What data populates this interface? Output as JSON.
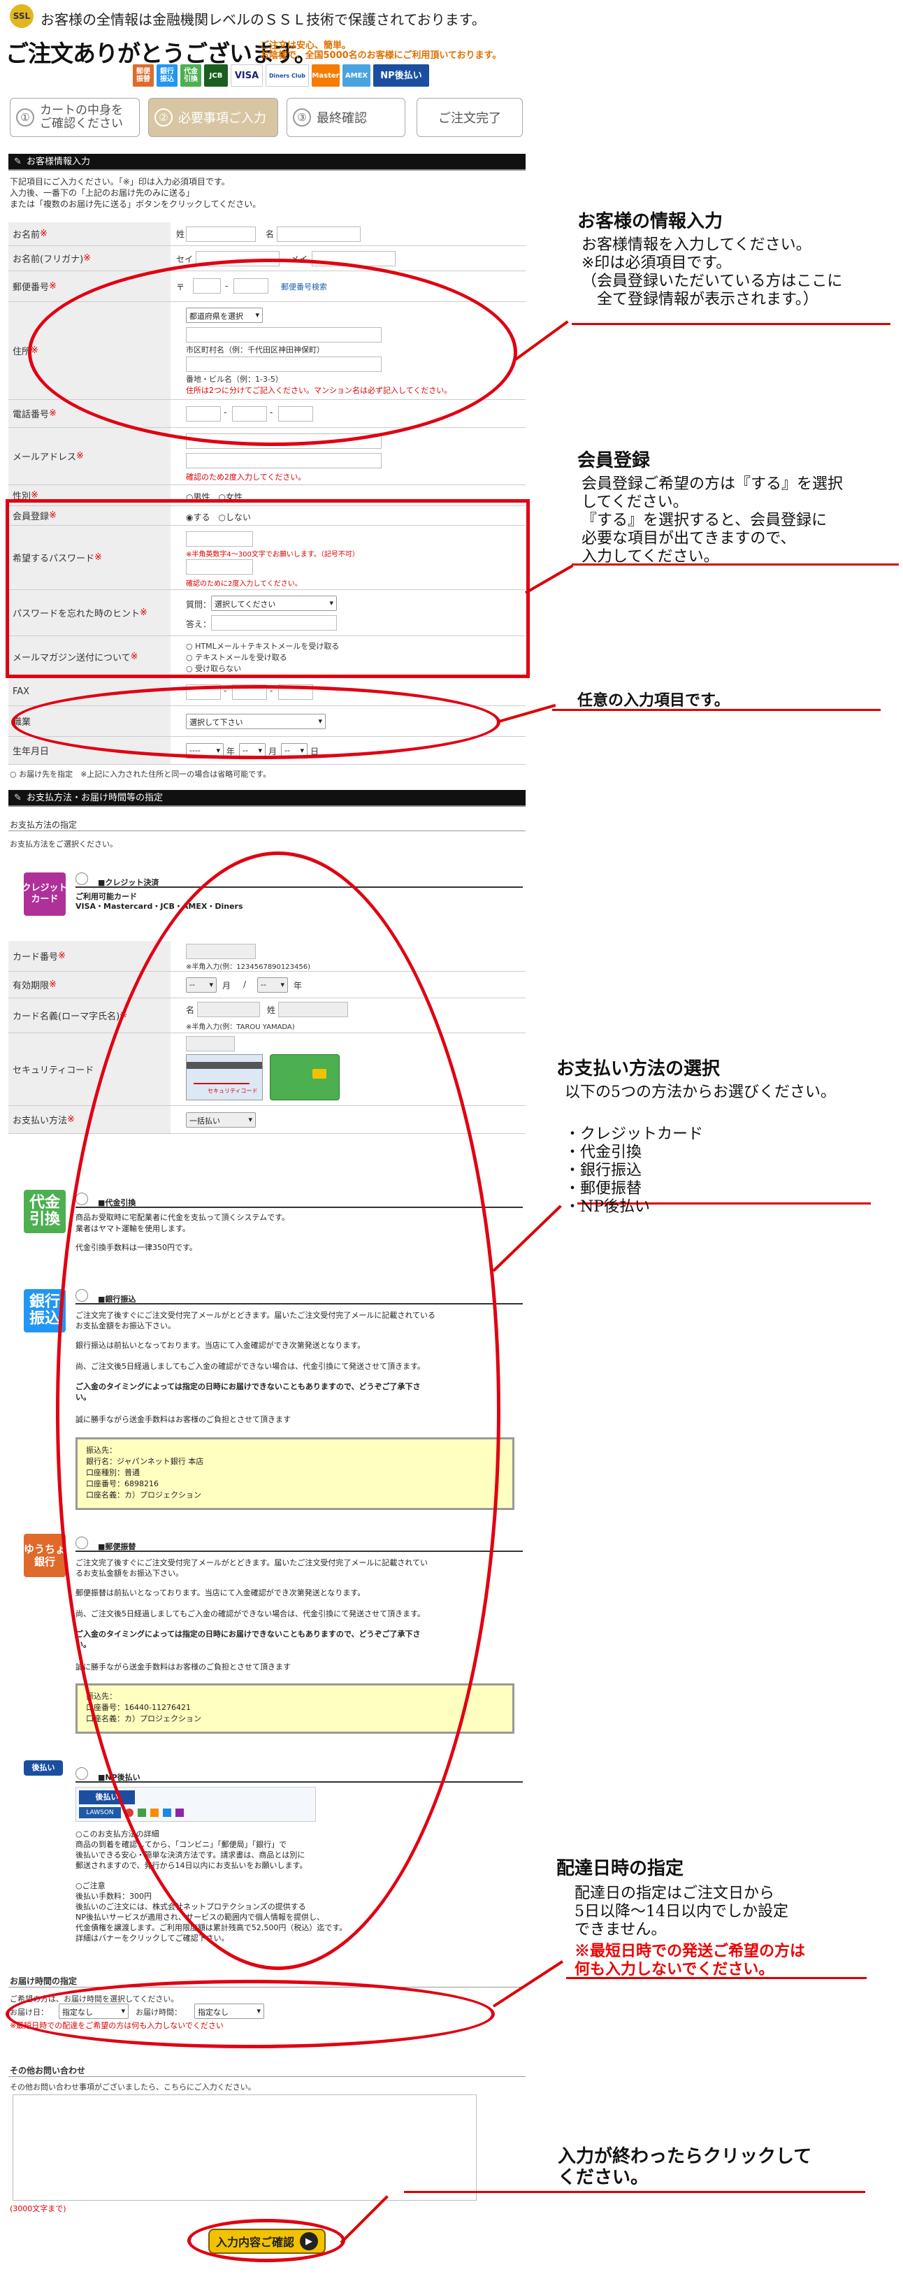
{
  "header": {
    "ssl_icon": "SSL",
    "ssl_text": "お客様の全情報は金融機関レベルのＳＳＬ技術で保護されております。",
    "thanks": "ご注文ありがとうございます。",
    "safe_line1": "ご注文は安心、簡単。",
    "safe_line2": "お陰様で、全国5000名のお客様にご利用頂いております。",
    "payment_badges": [
      "郵便振替",
      "銀行振込",
      "代金引換",
      "JCB",
      "VISA",
      "Diners Club",
      "Master",
      "AMEX",
      "NP後払い"
    ]
  },
  "steps": [
    {
      "num": "①",
      "label": "カートの中身を\nご確認ください"
    },
    {
      "num": "②",
      "label": "必要事項ご入力"
    },
    {
      "num": "③",
      "label": "最終確認"
    },
    {
      "num": "",
      "label": "ご注文完了"
    }
  ],
  "customer": {
    "section_title": "お客様情報入力",
    "intro": "下記項目にご入力ください。「※」印は入力必須項目です。\n入力後、一番下の「上記のお届け先のみに送る」\nまたは「複数のお届け先に送る」ボタンをクリックしてください。",
    "name_label": "お名前",
    "sei": "姓",
    "mei": "名",
    "kana_label": "お名前(フリガナ)",
    "kana_sei": "セイ",
    "kana_mei": "メイ",
    "zip_label": "郵便番号",
    "zip_mark": "〒",
    "zip_search": "郵便番号検索",
    "address_label": "住所",
    "pref_select": "都道府県を選択",
    "city_hint": "市区町村名（例：千代田区神田神保町）",
    "bldg_hint": "番地・ビル名（例：1-3-5）",
    "address_note": "住所は2つに分けてご記入ください。マンション名は必ず記入してください。",
    "phone_label": "電話番号",
    "email_label": "メールアドレス",
    "email_note": "確認のため2度入力してください。",
    "gender_label": "性別",
    "gender_opts": "○男性　○女性",
    "member_label": "会員登録",
    "member_opts": "◉する　○しない",
    "password_label": "希望するパスワード",
    "password_note": "※半角英数字4～300文字でお願いします。（記号不可）",
    "password_note2": "確認のために2度入力してください。",
    "hint_label": "パスワードを忘れた時のヒント",
    "hint_q": "質問：",
    "hint_select": "選択してください",
    "hint_a": "答え：",
    "mag_label": "メールマガジン送付について",
    "mag_opt1": "○ HTMLメール＋テキストメールを受け取る",
    "mag_opt2": "○ テキストメールを受け取る",
    "mag_opt3": "○ 受け取らない",
    "fax_label": "FAX",
    "job_label": "職業",
    "job_select": "選択して下さい",
    "birth_label": "生年月日",
    "birth_y": "----",
    "birth_year": "年",
    "birth_m": "--",
    "birth_month": "月",
    "birth_d": "--",
    "birth_day": "日",
    "ship_same": "○ お届け先を指定　※上記に入力された住所と同一の場合は省略可能です。"
  },
  "payment": {
    "section_title": "お支払方法・お届け時間等の指定",
    "sub_title": "お支払方法の指定",
    "sub_note": "お支払方法をご選択ください。",
    "credit_icon": "クレジット\nカード",
    "credit_title": "■クレジット決済",
    "credit_brands": "ご利用可能カード\nVISA・Mastercard・JCB・AMEX・Diners",
    "card_no_label": "カード番号",
    "card_no_hint": "※半角入力(例：1234567890123456)",
    "expiry_label": "有効期限",
    "expiry_m": "--",
    "expiry_month": "月",
    "expiry_slash": "/",
    "expiry_y": "--",
    "expiry_year": "年",
    "card_name_label": "カード名義(ローマ字氏名)",
    "card_name_mei": "名",
    "card_name_sei": "姓",
    "card_name_hint": "※半角入力(例：TAROU YAMADA)",
    "security_label": "セキュリティコード",
    "security_card_label": "セキュリティコード",
    "pay_count_label": "お支払い方法",
    "pay_count_select": "一括払い",
    "cod_icon": "代金\n引換",
    "cod_title": "■代金引換",
    "cod_text": "商品お受取時に宅配業者に代金を支払って頂くシステムです。\n業者はヤマト運輸を使用します。",
    "cod_fee": "代金引換手数料は一律350円です。",
    "bank_icon": "銀行\n振込",
    "bank_title": "■銀行振込",
    "bank_text1": "ご注文完了後すぐにご注文受付完了メールがとどきます。届いたご注文受付完了メールに記載されている\nお支払金額をお振込下さい。",
    "bank_text2": "銀行振込は前払いとなっております。当店にて入金確認ができ次第発送となります。",
    "bank_text3": "尚、ご注文後5日経過しましてもご入金の確認ができない場合は、代金引換にて発送させて頂きます。",
    "bank_text4": "ご入金のタイミングによっては指定の日時にお届けできないこともありますので、どうぞご了承下さ\nい。",
    "bank_text5": "誠に勝手ながら送金手数料はお客様のご負担とさせて頂きます",
    "bank_box": "振込先：\n銀行名：ジャパンネット銀行 本店\n口座種別：普通\n口座番号：6898216\n口座名義：カ）プロジェクション",
    "post_icon": "ゆうちょ\n銀行",
    "post_title": "■郵便振替",
    "post_text1": "ご注文完了後すぐにご注文受付完了メールがとどきます。届いたご注文受付完了メールに記載されてい\nるお支払金額をお振込下さい。",
    "post_text2": "郵便振替は前払いとなっております。当店にて入金確認ができ次第発送となります。",
    "post_text3": "尚、ご注文後5日経過しましてもご入金の確認ができない場合は、代金引換にて発送させて頂きます。",
    "post_text4": "ご入金のタイミングによっては指定の日時にお届けできないこともありますので、どうぞご了承下さ\nい。",
    "post_text5": "誠に勝手ながら送金手数料はお客様のご負担とさせて頂きます",
    "post_box": "振込先：\n口座番号：16440-11276421\n口座名義：カ）プロジェクション",
    "np_icon": "後払い",
    "np_title": "■NP後払い",
    "np_banner": "後払い",
    "np_stores": "LAWSON",
    "np_text": "○このお支払方法の詳細\n商品の到着を確認してから、「コンビニ」「郵便局」「銀行」で\n後払いできる安心・簡単な決済方法です。請求書は、商品とは別に\n郵送されますので、発行から14日以内にお支払いをお願いします。",
    "np_note": "○ご注意\n後払い手数料：300円\n後払いのご注文には、株式会社ネットプロテクションズの提供する\nNP後払いサービスが適用され、サービスの範囲内で個人情報を提供し、\n代金債権を譲渡します。ご利用限度額は累計残高で52,500円（税込）迄です。\n詳細はバナーをクリックしてご確認下さい。"
  },
  "delivery": {
    "title": "お届け時間の指定",
    "text": "ご希望の方は、お届け時間を選択してください。",
    "date_label": "お届け日：",
    "date_select": "指定なし",
    "time_label": "お届け時間：",
    "time_select": "指定なし",
    "note": "※最短日時での配達をご希望の方は何も入力しないでください"
  },
  "other": {
    "title": "その他お問い合わせ",
    "text": "その他お問い合わせ事項がございましたら、こちらにご入力ください。",
    "limit": "(3000文字まで)"
  },
  "submit_label": "入力内容ご確認",
  "annotations": {
    "a1_title": "お客様の情報入力",
    "a1_text": "お客様情報を入力してください。\n※印は必須項目です。\n（会員登録いただいている方はここに\n　全て登録情報が表示されます。）",
    "a2_title": "会員登録",
    "a2_text": "会員登録ご希望の方は『する』を選択\nしてください。\n『する』を選択すると、会員登録に\n必要な項目が出てきますので、\n入力してください。",
    "a3_title": "任意の入力項目です。",
    "a4_title": "お支払い方法の選択",
    "a4_text": "以下の5つの方法からお選びください。",
    "a4_list": "・クレジットカード\n・代金引換\n・銀行振込\n・郵便振替\n・NP後払い",
    "a5_title": "配達日時の指定",
    "a5_text": "配達日の指定はご注文日から\n5日以降～14日以内でしか設定\nできません。",
    "a5_red": "※最短日時での発送ご希望の方は\n何も入力しないでください。",
    "a6_title": "入力が終わったらクリックして\nください。"
  },
  "colors": {
    "accent_red": "#e00012",
    "step_active": "#d8c6a3",
    "credit": "#b0309a",
    "cod": "#4caf50",
    "bank": "#2196f3",
    "post": "#e06a2b",
    "np": "#1a4fa0"
  }
}
